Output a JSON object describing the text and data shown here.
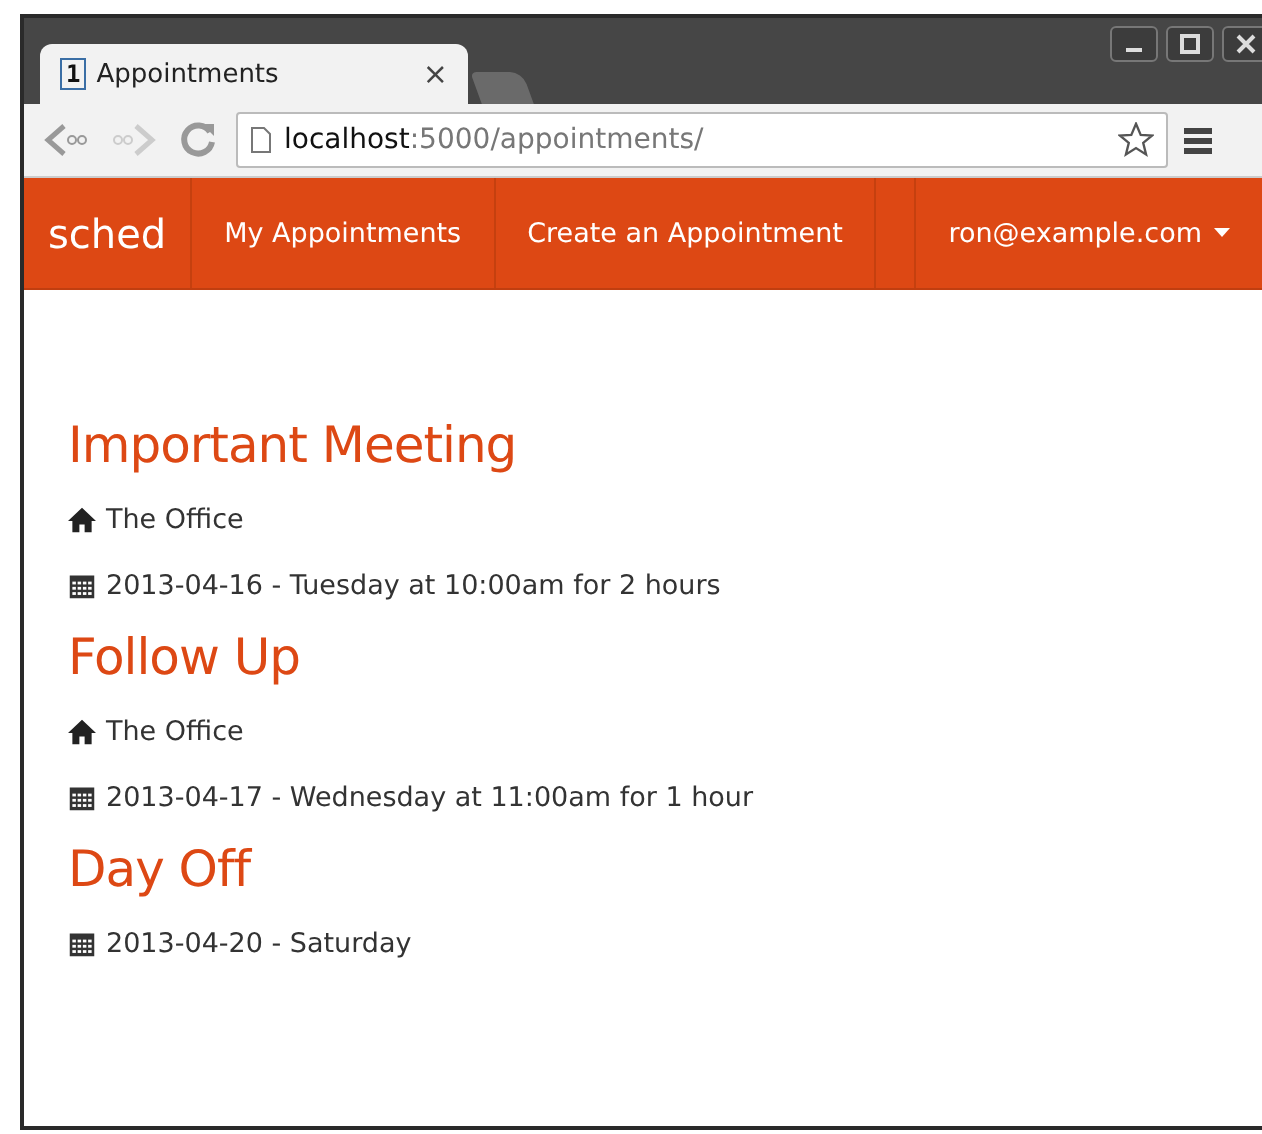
{
  "browser": {
    "tabs": [
      {
        "favicon": "1",
        "title": "Appointments",
        "close": "×",
        "selected": true
      }
    ],
    "address": {
      "host": "localhost",
      "path": ":5000/appointments/"
    }
  },
  "navbar": {
    "brand": "sched",
    "items": [
      {
        "label": "My Appointments"
      },
      {
        "label": "Create an Appointment"
      }
    ],
    "user": "ron@example.com"
  },
  "appointments": [
    {
      "title": "Important Meeting",
      "location": "The Office",
      "when": "2013-04-16 - Tuesday at 10:00am for 2 hours"
    },
    {
      "title": "Follow Up",
      "location": "The Office",
      "when": "2013-04-17 - Wednesday at 11:00am for 1 hour"
    },
    {
      "title": "Day Off",
      "when": "2013-04-20 - Saturday"
    }
  ]
}
